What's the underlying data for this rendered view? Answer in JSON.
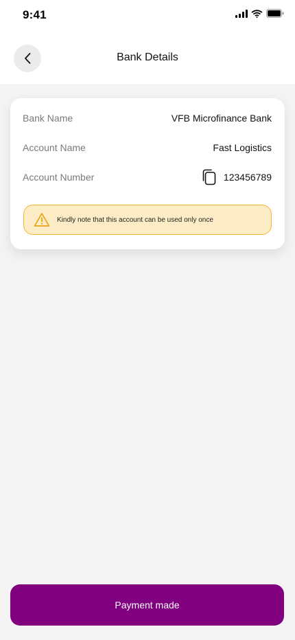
{
  "status_bar": {
    "time": "9:41",
    "icons": [
      "signal-icon",
      "wifi-icon",
      "battery-icon"
    ]
  },
  "header": {
    "title": "Bank Details",
    "back_icon": "chevron-left-icon"
  },
  "bank_details": {
    "bank_name_label": "Bank Name",
    "bank_name_value": "VFB Microfinance Bank",
    "account_name_label": "Account Name",
    "account_name_value": "Fast Logistics",
    "account_number_label": "Account Number",
    "account_number_value": "123456789",
    "copy_icon": "copy-icon"
  },
  "notice": {
    "icon": "warning-icon",
    "text": "Kindly note that this account can be used only once"
  },
  "footer": {
    "button_label": "Payment made"
  },
  "colors": {
    "primary": "#800080",
    "notice_bg": "#fdecc5",
    "notice_border": "#f2b630",
    "warning_icon": "#e8a317",
    "background": "#f4f4f4"
  }
}
